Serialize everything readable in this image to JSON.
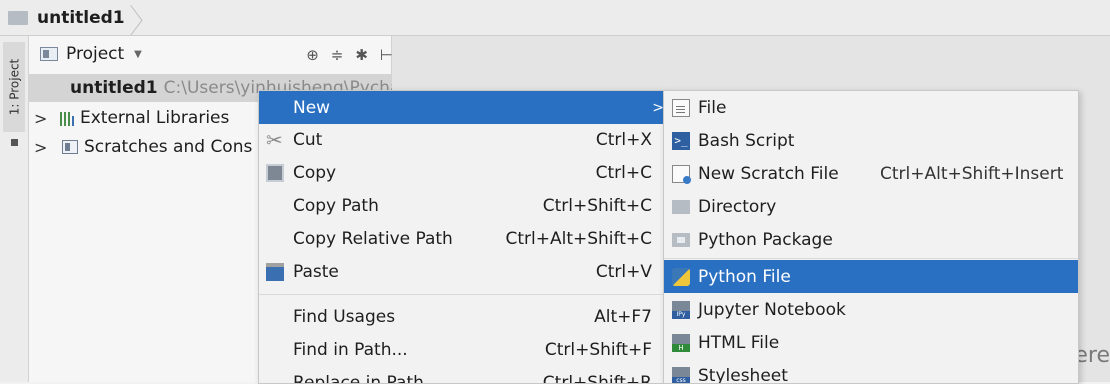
{
  "breadcrumb": {
    "project": "untitled1"
  },
  "toolstrip": {
    "project_tab": "1: Project"
  },
  "panel": {
    "title": "Project",
    "tree": [
      {
        "name": "untitled1",
        "path": "C:\\Users\\yinhuisheng\\PycharmProjects\\unti"
      },
      {
        "name": "External Libraries"
      },
      {
        "name": "Scratches and Cons"
      }
    ]
  },
  "editor": {
    "partial_text": "ere"
  },
  "context_menu": {
    "items": [
      {
        "label": "New",
        "shortcut": "",
        "submenu": true
      },
      {
        "label": "Cut",
        "shortcut": "Ctrl+X",
        "icon": "scissors-icon"
      },
      {
        "label": "Copy",
        "shortcut": "Ctrl+C",
        "icon": "copy-icon"
      },
      {
        "label": "Copy Path",
        "shortcut": "Ctrl+Shift+C"
      },
      {
        "label": "Copy Relative Path",
        "shortcut": "Ctrl+Alt+Shift+C"
      },
      {
        "label": "Paste",
        "shortcut": "Ctrl+V",
        "icon": "paste-icon"
      },
      {
        "label": "Find Usages",
        "shortcut": "Alt+F7"
      },
      {
        "label": "Find in Path...",
        "shortcut": "Ctrl+Shift+F"
      },
      {
        "label": "Replace in Path...",
        "shortcut": "Ctrl+Shift+R"
      }
    ]
  },
  "new_submenu": {
    "items": [
      {
        "label": "File",
        "icon": "file-icon"
      },
      {
        "label": "Bash Script",
        "icon": "bash-script-icon"
      },
      {
        "label": "New Scratch File",
        "shortcut": "Ctrl+Alt+Shift+Insert",
        "icon": "scratch-file-icon"
      },
      {
        "label": "Directory",
        "icon": "folder-icon"
      },
      {
        "label": "Python Package",
        "icon": "package-icon"
      },
      {
        "label": "Python File",
        "icon": "python-file-icon"
      },
      {
        "label": "Jupyter Notebook",
        "icon": "jupyter-notebook-icon"
      },
      {
        "label": "HTML File",
        "icon": "html-file-icon"
      },
      {
        "label": "Stylesheet",
        "icon": "css-file-icon"
      }
    ]
  },
  "colors": {
    "selection": "#2a70c2",
    "tree_selected": "#d4d4d4"
  }
}
